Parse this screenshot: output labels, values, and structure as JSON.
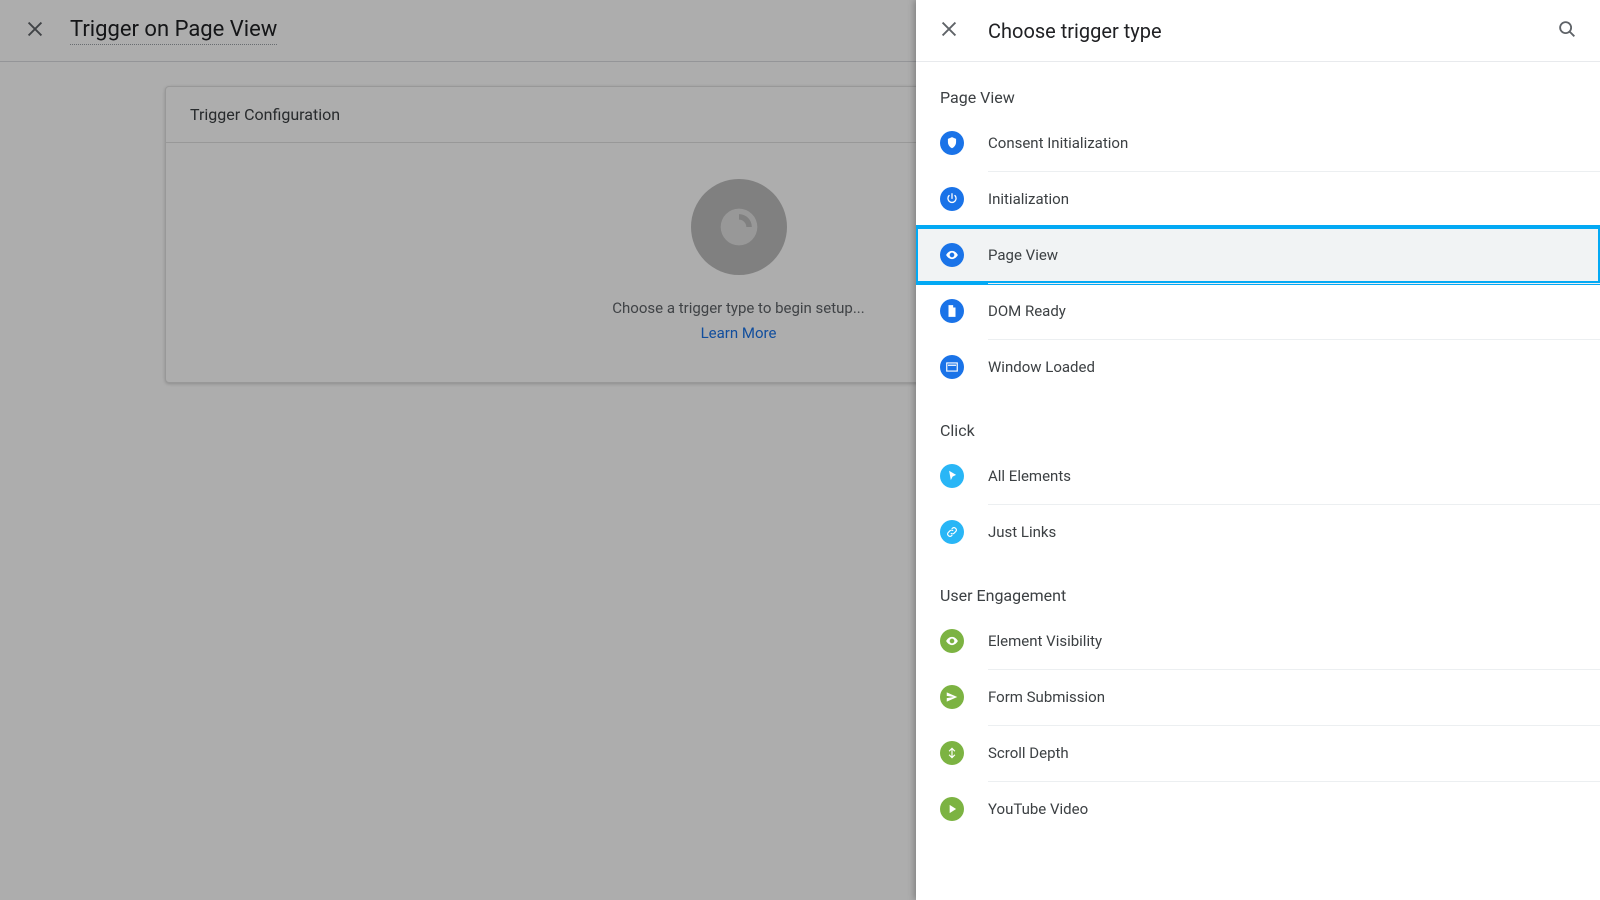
{
  "bg": {
    "title": "Trigger on Page View",
    "config_header": "Trigger Configuration",
    "choose_text": "Choose a trigger type to begin setup...",
    "learn_more": "Learn More"
  },
  "panel": {
    "title": "Choose trigger type",
    "sections": [
      {
        "title": "Page View",
        "items": [
          {
            "label": "Consent Initialization",
            "icon": "shield",
            "color": "c-blue",
            "selected": false
          },
          {
            "label": "Initialization",
            "icon": "power",
            "color": "c-blue",
            "selected": false
          },
          {
            "label": "Page View",
            "icon": "eye",
            "color": "c-blue",
            "selected": true
          },
          {
            "label": "DOM Ready",
            "icon": "doc",
            "color": "c-blue",
            "selected": false
          },
          {
            "label": "Window Loaded",
            "icon": "window",
            "color": "c-blue",
            "selected": false
          }
        ]
      },
      {
        "title": "Click",
        "items": [
          {
            "label": "All Elements",
            "icon": "cursor",
            "color": "c-cyan",
            "selected": false
          },
          {
            "label": "Just Links",
            "icon": "link",
            "color": "c-cyan",
            "selected": false
          }
        ]
      },
      {
        "title": "User Engagement",
        "items": [
          {
            "label": "Element Visibility",
            "icon": "eye",
            "color": "c-green",
            "selected": false
          },
          {
            "label": "Form Submission",
            "icon": "send",
            "color": "c-green",
            "selected": false
          },
          {
            "label": "Scroll Depth",
            "icon": "scroll",
            "color": "c-green",
            "selected": false
          },
          {
            "label": "YouTube Video",
            "icon": "play",
            "color": "c-green",
            "selected": false
          }
        ]
      }
    ]
  }
}
